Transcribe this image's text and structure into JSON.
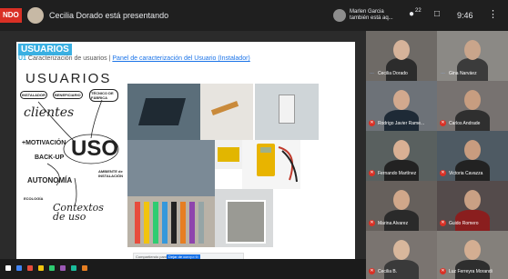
{
  "topbar": {
    "rec_label": "NDO",
    "presenter_text": "Cecilia Dorado está presentando",
    "notification_line1": "Marlen Garcia",
    "notification_line2": "también está aq...",
    "participant_count": "22",
    "time": "9:46"
  },
  "slide": {
    "title": "USUARIOS",
    "subtitle_unit": "U1",
    "subtitle_text": "Caracterización de usuarios |",
    "subtitle_link": "Panel de caracterización del Usuario (Instalador)",
    "sketch": {
      "word_usuarios": "USUARIOS",
      "instalador": "INSTALADOR",
      "beneficiario": "BENEFICIARIO",
      "tecnico": "TÉCNICO DE FÁBRICA",
      "clientes": "clientes",
      "motivacion": "+MOTIVACIÓN",
      "backup": "BACK-UP",
      "uso": "USO",
      "ambiente": "AMBIENTE de INSTALACIÓN",
      "autonomia": "AUTONOMÍA",
      "ecologia": "ECOLOGÍA",
      "contextos": "Contextos de uso"
    },
    "screen_share_bar": {
      "text": "Compartiendo pantalla",
      "stop_label": "Dejar de compartir",
      "hide_label": "Ocultar"
    }
  },
  "participants": [
    {
      "name": "Cecilia Dorado",
      "muted": false
    },
    {
      "name": "Gina Narváez",
      "muted": false
    },
    {
      "name": "Rodrigo Javier Rame...",
      "muted": true
    },
    {
      "name": "Carlos Andrade",
      "muted": true
    },
    {
      "name": "Fernando Martínez",
      "muted": true
    },
    {
      "name": "Victoria Cavazza",
      "muted": true
    },
    {
      "name": "Marina Alvarez",
      "muted": true
    },
    {
      "name": "Guido Romero",
      "muted": true
    },
    {
      "name": "Cecilia B.",
      "muted": true
    },
    {
      "name": "Luz Ferreyra Morandi",
      "muted": true
    }
  ],
  "colors": {
    "accent": "#3ab0e2",
    "mute_red": "#d93025",
    "bg_dark": "#202124"
  }
}
